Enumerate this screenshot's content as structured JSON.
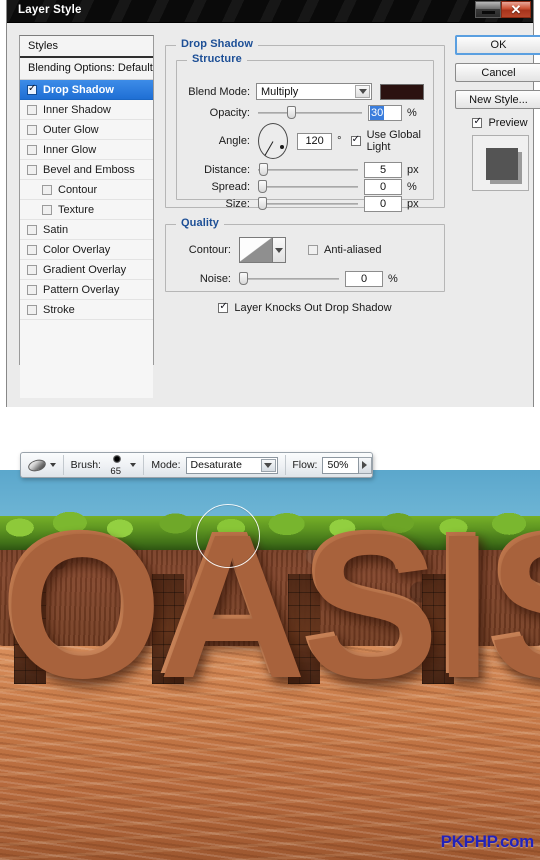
{
  "dialog": {
    "title": "Layer Style",
    "window_buttons": {
      "minimize": "minimize-icon",
      "close": "✕"
    },
    "styles_panel": {
      "header": "Styles",
      "blending_options": "Blending Options: Default",
      "items": [
        {
          "label": "Drop Shadow",
          "checked": true,
          "selected": true,
          "indent": false
        },
        {
          "label": "Inner Shadow",
          "checked": false,
          "selected": false,
          "indent": false
        },
        {
          "label": "Outer Glow",
          "checked": false,
          "selected": false,
          "indent": false
        },
        {
          "label": "Inner Glow",
          "checked": false,
          "selected": false,
          "indent": false
        },
        {
          "label": "Bevel and Emboss",
          "checked": false,
          "selected": false,
          "indent": false
        },
        {
          "label": "Contour",
          "checked": false,
          "selected": false,
          "indent": true
        },
        {
          "label": "Texture",
          "checked": false,
          "selected": false,
          "indent": true
        },
        {
          "label": "Satin",
          "checked": false,
          "selected": false,
          "indent": false
        },
        {
          "label": "Color Overlay",
          "checked": false,
          "selected": false,
          "indent": false
        },
        {
          "label": "Gradient Overlay",
          "checked": false,
          "selected": false,
          "indent": false
        },
        {
          "label": "Pattern Overlay",
          "checked": false,
          "selected": false,
          "indent": false
        },
        {
          "label": "Stroke",
          "checked": false,
          "selected": false,
          "indent": false
        }
      ]
    },
    "drop_shadow": {
      "group_label": "Drop Shadow",
      "structure": {
        "group_label": "Structure",
        "blend_mode": {
          "label": "Blend Mode:",
          "value": "Multiply"
        },
        "shadow_color": "#2b1210",
        "opacity": {
          "label": "Opacity:",
          "value": "30",
          "unit": "%",
          "slider_pct": 30
        },
        "angle": {
          "label": "Angle:",
          "value": "120",
          "unit": "°",
          "dial_degrees": 120
        },
        "use_global_light": {
          "label": "Use Global Light",
          "checked": true
        },
        "distance": {
          "label": "Distance:",
          "value": "5",
          "unit": "px",
          "slider_pct": 3
        },
        "spread": {
          "label": "Spread:",
          "value": "0",
          "unit": "%",
          "slider_pct": 0
        },
        "size": {
          "label": "Size:",
          "value": "0",
          "unit": "px",
          "slider_pct": 0
        }
      },
      "quality": {
        "group_label": "Quality",
        "contour": {
          "label": "Contour:"
        },
        "anti_aliased": {
          "label": "Anti-aliased",
          "checked": false
        },
        "noise": {
          "label": "Noise:",
          "value": "0",
          "unit": "%",
          "slider_pct": 0
        }
      },
      "layer_knocks_out": {
        "label": "Layer Knocks Out Drop Shadow",
        "checked": true
      }
    },
    "buttons": {
      "ok": "OK",
      "cancel": "Cancel",
      "new_style": "New Style...",
      "preview": {
        "label": "Preview",
        "checked": true
      }
    }
  },
  "brush_toolbar": {
    "tool_icon": "brush-tool-icon",
    "brush": {
      "label": "Brush:",
      "size": "65"
    },
    "mode": {
      "label": "Mode:",
      "value": "Desaturate"
    },
    "flow": {
      "label": "Flow:",
      "value": "50%"
    }
  },
  "artwork": {
    "text": "OASIS",
    "watermark": "PKPHP.com",
    "colors": {
      "sky": "#77bcd9",
      "grass": "#5d9421",
      "dirt": "#7d4123",
      "letters": "#c37b4f",
      "sand": "#c87b49",
      "watermark": "#2222bb"
    }
  }
}
